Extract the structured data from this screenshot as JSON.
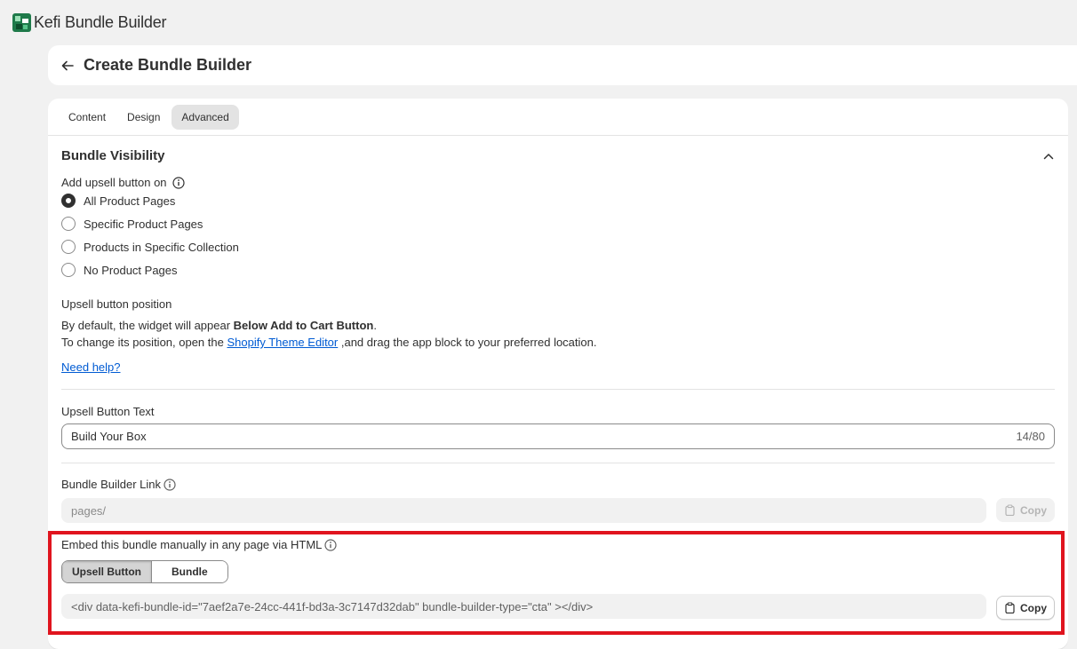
{
  "app": {
    "title": "Kefi Bundle Builder",
    "logo_icon": "kefi-logo-icon"
  },
  "header": {
    "title": "Create Bundle Builder",
    "back_icon": "arrow-left-icon"
  },
  "tabs": [
    {
      "label": "Content",
      "active": false
    },
    {
      "label": "Design",
      "active": false
    },
    {
      "label": "Advanced",
      "active": true
    }
  ],
  "visibility": {
    "title": "Bundle Visibility",
    "add_on_label": "Add upsell button on",
    "options": [
      {
        "label": "All Product Pages",
        "checked": true
      },
      {
        "label": "Specific Product Pages",
        "checked": false
      },
      {
        "label": "Products in Specific Collection",
        "checked": false
      },
      {
        "label": "No Product Pages",
        "checked": false
      }
    ]
  },
  "position": {
    "label": "Upsell button position",
    "line1_prefix": "By default, the widget will appear ",
    "line1_bold": "Below Add to Cart Button",
    "line1_suffix": ".",
    "line2_prefix": "To change its position, open the ",
    "line2_link": "Shopify Theme Editor",
    "line2_suffix": " ,and drag the app block to your preferred location.",
    "help_link": "Need help?"
  },
  "upsell_text": {
    "label": "Upsell Button Text",
    "value": "Build Your Box",
    "counter": "14/80"
  },
  "link": {
    "label": "Bundle Builder Link",
    "value": "pages/",
    "copy_label": "Copy"
  },
  "embed": {
    "label": "Embed this bundle manually in any page via HTML",
    "segments": [
      {
        "label": "Upsell Button",
        "active": true
      },
      {
        "label": "Bundle",
        "active": false
      }
    ],
    "code": "<div data-kefi-bundle-id=\"7aef2a7e-24cc-441f-bd3a-3c7147d32dab\" bundle-builder-type=\"cta\" ></div>",
    "copy_label": "Copy"
  },
  "colors": {
    "accent_link": "#005bd3",
    "highlight": "#e0141e",
    "background": "#f1f1f1"
  }
}
